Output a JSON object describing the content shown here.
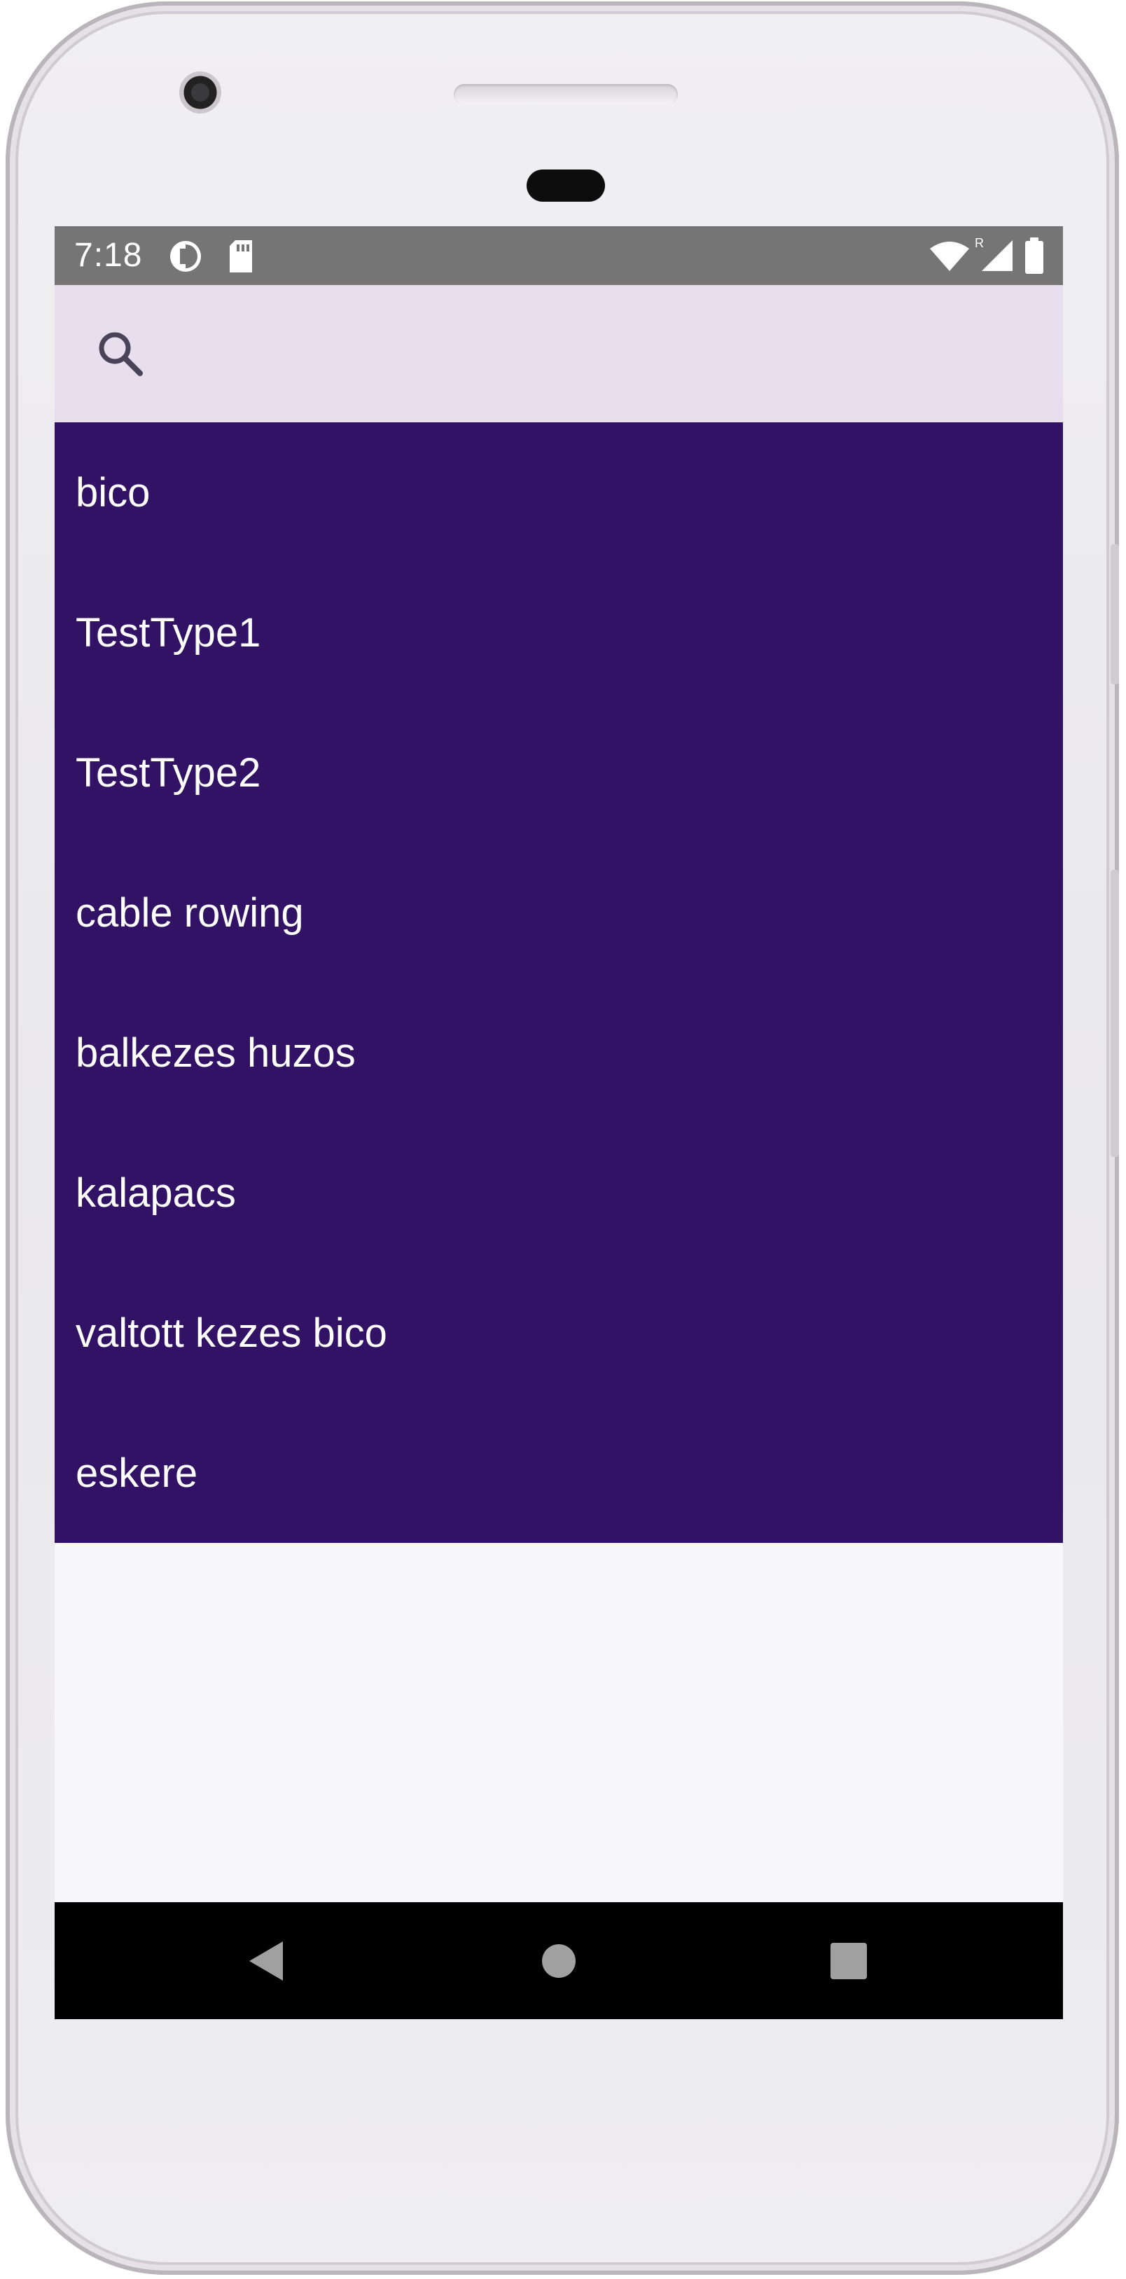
{
  "status_bar": {
    "time": "7:18",
    "left_icons": [
      "data-saver-icon",
      "sd-card-icon"
    ],
    "right_icons": [
      "wifi-icon",
      "signal-roaming-icon",
      "battery-icon"
    ],
    "roaming_indicator": "R",
    "background_color": "#757575"
  },
  "search": {
    "icon": "search-icon",
    "value": "",
    "placeholder": "",
    "background_color": "#e7dfee"
  },
  "list": {
    "background_color": "#311265",
    "text_color": "#ffffff",
    "items": [
      {
        "label": "bico"
      },
      {
        "label": "TestType1"
      },
      {
        "label": "TestType2"
      },
      {
        "label": "cable rowing"
      },
      {
        "label": "balkezes huzos"
      },
      {
        "label": "kalapacs"
      },
      {
        "label": "valtott kezes bico"
      },
      {
        "label": "eskere"
      }
    ]
  },
  "nav_bar": {
    "buttons": [
      "back-icon",
      "home-icon",
      "recents-icon"
    ]
  }
}
